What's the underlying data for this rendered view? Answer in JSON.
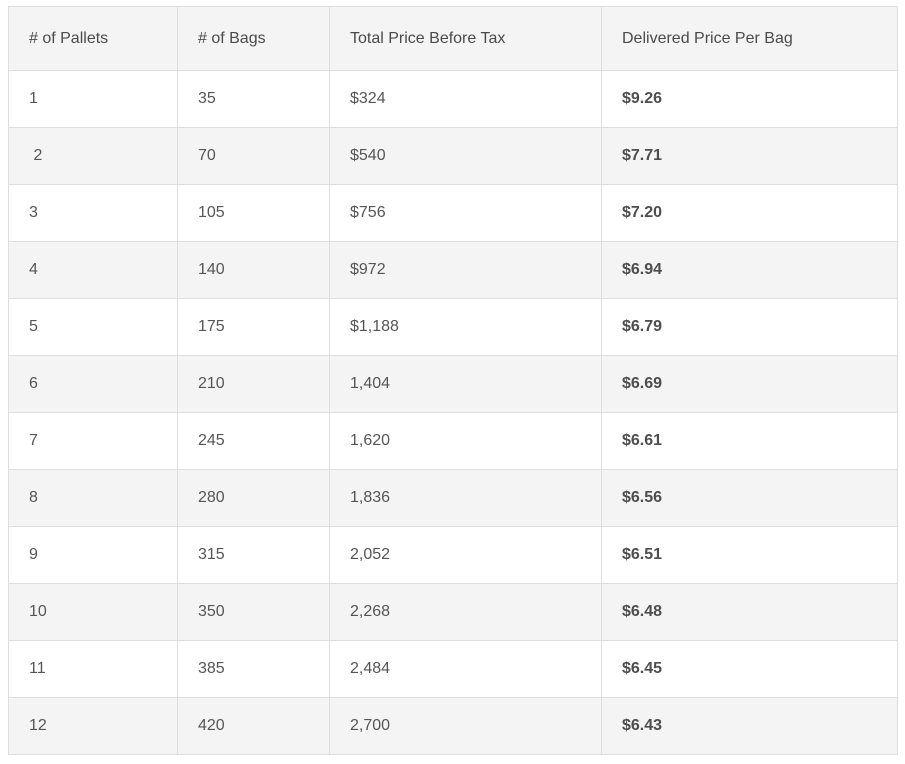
{
  "table": {
    "headers": [
      "# of Pallets",
      "# of Bags",
      "Total Price Before Tax",
      "Delivered Price Per Bag"
    ],
    "rows": [
      [
        "1",
        "35",
        "$324",
        "$9.26"
      ],
      [
        " 2",
        "70",
        "$540",
        "$7.71"
      ],
      [
        "3",
        "105",
        "$756",
        "$7.20"
      ],
      [
        "4",
        "140",
        "$972",
        "$6.94"
      ],
      [
        "5",
        "175",
        "$1,188",
        "$6.79"
      ],
      [
        "6",
        "210",
        "1,404",
        "$6.69"
      ],
      [
        "7",
        "245",
        "1,620",
        "$6.61"
      ],
      [
        "8",
        "280",
        "1,836",
        "$6.56"
      ],
      [
        "9",
        "315",
        "2,052",
        "$6.51"
      ],
      [
        "10",
        "350",
        "2,268",
        "$6.48"
      ],
      [
        "11",
        "385",
        "2,484",
        "$6.45"
      ],
      [
        "12",
        "420",
        "2,700",
        "$6.43"
      ]
    ]
  },
  "colors": {
    "header_bg": "#f4f4f4",
    "row_alt_bg": "#f4f4f4",
    "border": "#dedede",
    "text": "#555555"
  }
}
